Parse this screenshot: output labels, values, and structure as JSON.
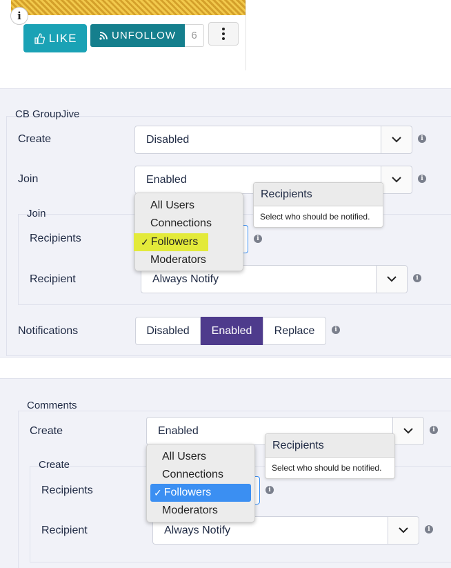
{
  "toolbar": {
    "info_glyph": "i",
    "like_label": "LIKE",
    "unfollow_label": "UNFOLLOW",
    "follower_count": "6"
  },
  "groupjive": {
    "legend": "CB GroupJive",
    "create_label": "Create",
    "create_value": "Disabled",
    "join_label": "Join",
    "join_value": "Enabled",
    "join_fieldset_legend": "Join",
    "recipients_label": "Recipients",
    "recipient_label": "Recipient",
    "recipient_value": "Always Notify",
    "notifications_label": "Notifications",
    "notifications_options": [
      "Disabled",
      "Enabled",
      "Replace"
    ],
    "notifications_selected": "Enabled",
    "dropdown_options": [
      "All Users",
      "Connections",
      "Followers",
      "Moderators"
    ],
    "dropdown_selected": "Followers",
    "check": "✓",
    "tooltip_title": "Recipients",
    "tooltip_body": "Select who should be notified."
  },
  "comments": {
    "legend": "Comments",
    "create_label": "Create",
    "create_value": "Enabled",
    "create_fieldset_legend": "Create",
    "recipients_label": "Recipients",
    "recipient_label": "Recipient",
    "recipient_value": "Always Notify",
    "dropdown_options": [
      "All Users",
      "Connections",
      "Followers",
      "Moderators"
    ],
    "dropdown_selected": "Followers",
    "check": "✓",
    "tooltip_title": "Recipients",
    "tooltip_body": "Select who should be notified."
  },
  "colors": {
    "like": "#1aa2b5",
    "unfollow": "#157f8d",
    "segment_active": "#4e3b8c",
    "highlight": "#e3ea3a",
    "dropdown_selected": "#3b8ff2"
  }
}
